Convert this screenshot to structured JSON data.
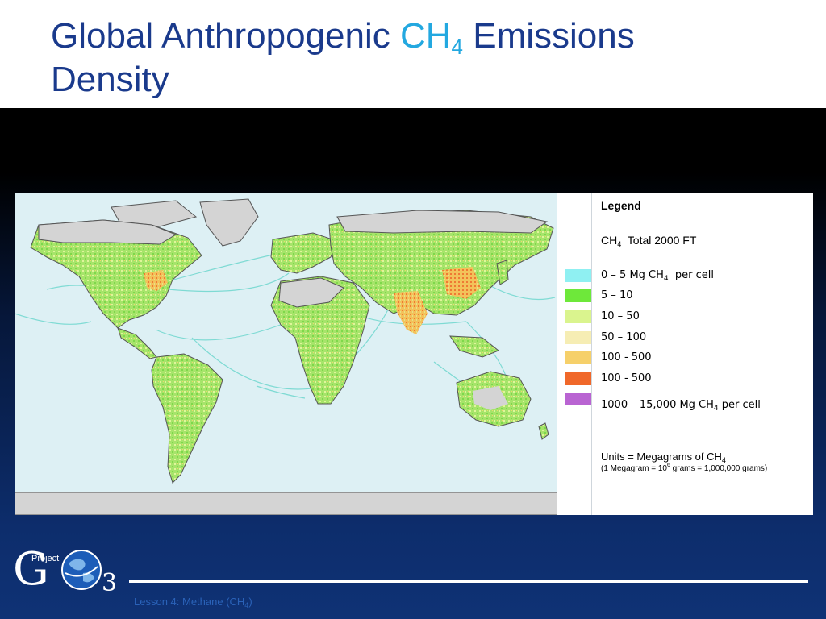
{
  "title": {
    "part1": "Global Anthropogenic ",
    "chem_main": "CH",
    "chem_sub": "4",
    "part2": " Emissions",
    "line2": "Density"
  },
  "legend": {
    "heading": "Legend",
    "subtitle_main": "CH",
    "subtitle_sub": "4",
    "subtitle_rest": "Total 2000 FT",
    "items": [
      {
        "pre": "0 – 5 Mg CH",
        "sub": "4",
        "post": "per cell",
        "color": "#8ff0f2"
      },
      {
        "pre": "5 – 10",
        "sub": "",
        "post": "",
        "color": "#6ee83a"
      },
      {
        "pre": "10 – 50",
        "sub": "",
        "post": "",
        "color": "#daf48e"
      },
      {
        "pre": "50 – 100",
        "sub": "",
        "post": "",
        "color": "#f6edb4"
      },
      {
        "pre": "100 - 500",
        "sub": "",
        "post": "",
        "color": "#f6d06a"
      },
      {
        "pre": "100 - 500",
        "sub": "",
        "post": "",
        "color": "#f0682a"
      },
      {
        "pre": "1000 – 15,000 Mg CH",
        "sub": "4",
        "post": "per cell",
        "color": "#b964d2"
      }
    ],
    "units": {
      "main_pre": "Units = Megagrams of CH",
      "main_sub": "4",
      "note_pre": "(1 Megagram = 10",
      "note_sup": "6",
      "note_post": " grams = 1,000,000 grams)"
    }
  },
  "logo": {
    "letter_g": "G",
    "project": "Project",
    "number": "3"
  },
  "footer": {
    "pre": "Lesson 4:  Methane (CH",
    "sub": "4",
    "post": ")"
  },
  "colors": {
    "title": "#1a3a8c",
    "chem_accent": "#23a8e0",
    "ocean": "#ddf0f4",
    "land_outline": "#555555",
    "land_gray": "#d4d4d4",
    "footer_text": "#2a62b8"
  }
}
